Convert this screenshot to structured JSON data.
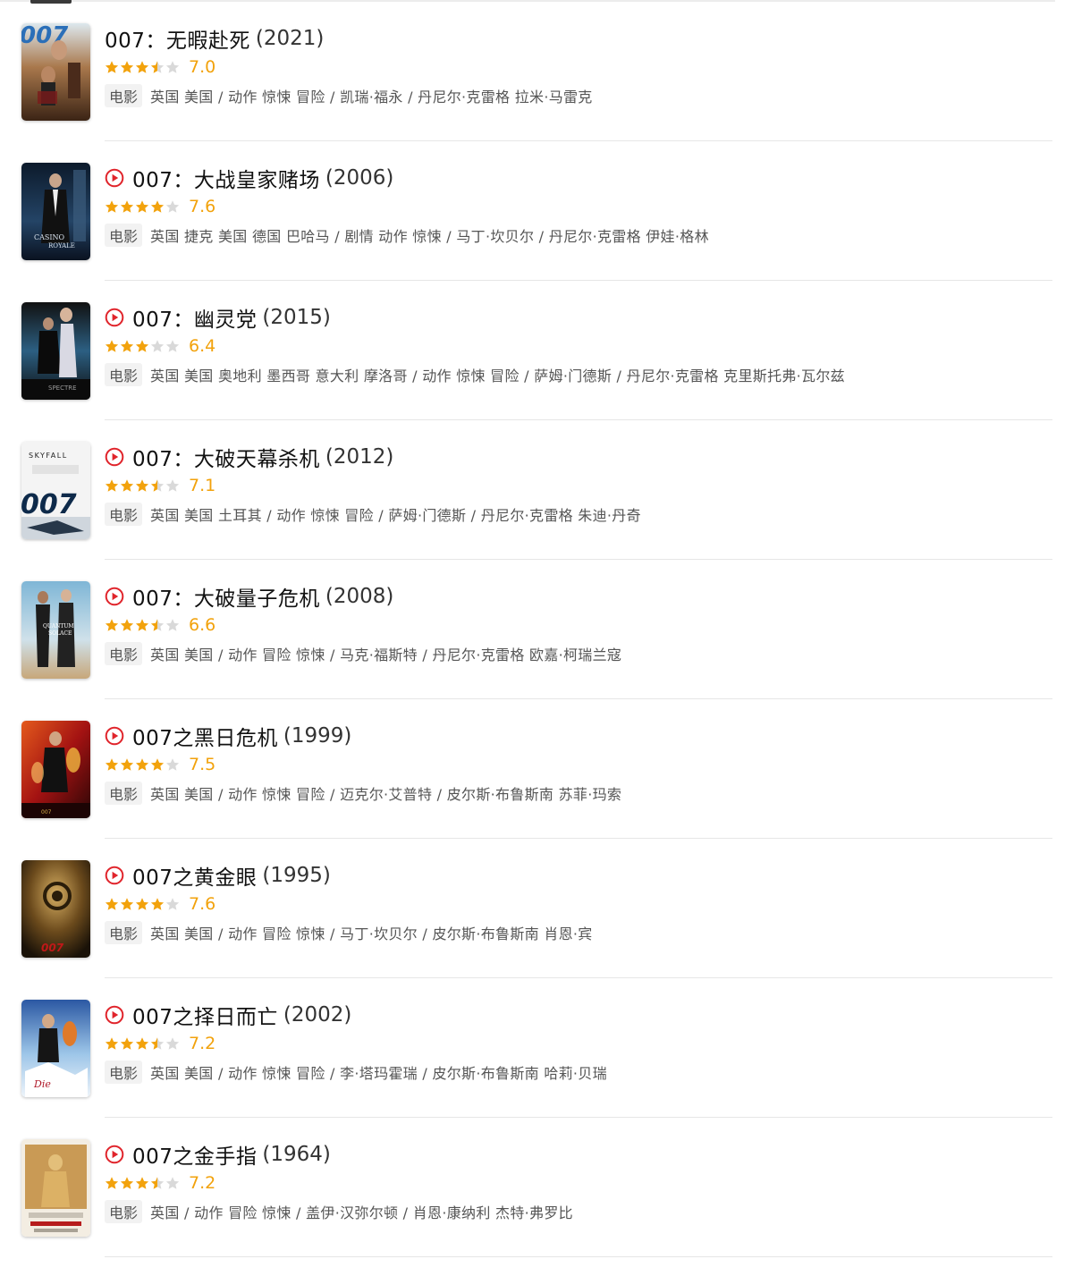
{
  "accent_colors": {
    "star": "#f2a20c",
    "star_empty": "#d9d9d9",
    "play": "#e0242b"
  },
  "movies": [
    {
      "title": "007：无暇赴死",
      "year": "(2021)",
      "playable": false,
      "rating": 7.0,
      "rating_text": "7.0",
      "stars": 3.5,
      "tag": "电影",
      "meta": "英国 美国 / 动作 惊悚 冒险 / 凯瑞·福永 / 丹尼尔·克雷格 拉米·马雷克"
    },
    {
      "title": "007：大战皇家赌场",
      "year": "(2006)",
      "playable": true,
      "rating": 7.6,
      "rating_text": "7.6",
      "stars": 4,
      "tag": "电影",
      "meta": "英国 捷克 美国 德国 巴哈马 / 剧情 动作 惊悚 / 马丁·坎贝尔 / 丹尼尔·克雷格 伊娃·格林"
    },
    {
      "title": "007：幽灵党",
      "year": "(2015)",
      "playable": true,
      "rating": 6.4,
      "rating_text": "6.4",
      "stars": 3,
      "tag": "电影",
      "meta": "英国 美国 奥地利 墨西哥 意大利 摩洛哥 / 动作 惊悚 冒险 / 萨姆·门德斯 / 丹尼尔·克雷格 克里斯托弗·瓦尔兹"
    },
    {
      "title": "007：大破天幕杀机",
      "year": "(2012)",
      "playable": true,
      "rating": 7.1,
      "rating_text": "7.1",
      "stars": 3.5,
      "tag": "电影",
      "meta": "英国 美国 土耳其 / 动作 惊悚 冒险 / 萨姆·门德斯 / 丹尼尔·克雷格 朱迪·丹奇"
    },
    {
      "title": "007：大破量子危机",
      "year": "(2008)",
      "playable": true,
      "rating": 6.6,
      "rating_text": "6.6",
      "stars": 3.5,
      "tag": "电影",
      "meta": "英国 美国 / 动作 冒险 惊悚 / 马克·福斯特 / 丹尼尔·克雷格 欧嘉·柯瑞兰寇"
    },
    {
      "title": "007之黑日危机",
      "year": "(1999)",
      "playable": true,
      "rating": 7.5,
      "rating_text": "7.5",
      "stars": 4,
      "tag": "电影",
      "meta": "英国 美国 / 动作 惊悚 冒险 / 迈克尔·艾普特 / 皮尔斯·布鲁斯南 苏菲·玛索"
    },
    {
      "title": "007之黄金眼",
      "year": "(1995)",
      "playable": true,
      "rating": 7.6,
      "rating_text": "7.6",
      "stars": 4,
      "tag": "电影",
      "meta": "英国 美国 / 动作 冒险 惊悚 / 马丁·坎贝尔 / 皮尔斯·布鲁斯南 肖恩·宾"
    },
    {
      "title": "007之择日而亡",
      "year": "(2002)",
      "playable": true,
      "rating": 7.2,
      "rating_text": "7.2",
      "stars": 3.5,
      "tag": "电影",
      "meta": "英国 美国 / 动作 惊悚 冒险 / 李·塔玛霍瑞 / 皮尔斯·布鲁斯南 哈莉·贝瑞"
    },
    {
      "title": "007之金手指",
      "year": "(1964)",
      "playable": true,
      "rating": 7.2,
      "rating_text": "7.2",
      "stars": 3.5,
      "tag": "电影",
      "meta": "英国 / 动作 冒险 惊悚 / 盖伊·汉弥尔顿 / 肖恩·康纳利 杰特·弗罗比"
    }
  ]
}
